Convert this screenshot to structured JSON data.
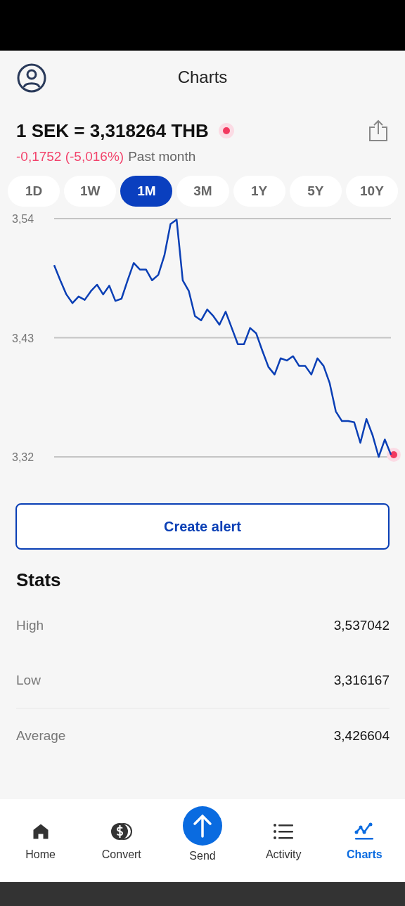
{
  "header": {
    "title": "Charts"
  },
  "rate": {
    "text": "1 SEK = 3,318264 THB",
    "live": true,
    "change": "-0,1752 (-5,016%)",
    "period": "Past month"
  },
  "ranges": [
    {
      "label": "1D",
      "selected": false
    },
    {
      "label": "1W",
      "selected": false
    },
    {
      "label": "1M",
      "selected": true
    },
    {
      "label": "3M",
      "selected": false
    },
    {
      "label": "1Y",
      "selected": false
    },
    {
      "label": "5Y",
      "selected": false
    },
    {
      "label": "10Y",
      "selected": false
    }
  ],
  "chart": {
    "chart_data": {
      "type": "line",
      "ylim": [
        3.32,
        3.54
      ],
      "yticks": [
        {
          "value": 3.54,
          "label": "3,54"
        },
        {
          "value": 3.43,
          "label": "3,43"
        },
        {
          "value": 3.32,
          "label": "3,32"
        }
      ],
      "series": [
        {
          "color": "#0a3fb5",
          "values": [
            3.497,
            3.483,
            3.47,
            3.462,
            3.468,
            3.465,
            3.473,
            3.479,
            3.47,
            3.478,
            3.464,
            3.466,
            3.483,
            3.499,
            3.493,
            3.493,
            3.483,
            3.488,
            3.506,
            3.535,
            3.539,
            3.483,
            3.473,
            3.45,
            3.446,
            3.456,
            3.45,
            3.442,
            3.454,
            3.439,
            3.424,
            3.424,
            3.439,
            3.434,
            3.418,
            3.403,
            3.396,
            3.411,
            3.409,
            3.413,
            3.404,
            3.404,
            3.396,
            3.411,
            3.404,
            3.388,
            3.362,
            3.353,
            3.353,
            3.352,
            3.333,
            3.355,
            3.34,
            3.32,
            3.336,
            3.322
          ]
        }
      ]
    }
  },
  "alert_button": "Create alert",
  "stats": {
    "title": "Stats",
    "rows": [
      {
        "label": "High",
        "value": "3,537042"
      },
      {
        "label": "Low",
        "value": "3,316167"
      },
      {
        "label": "Average",
        "value": "3,426604"
      }
    ]
  },
  "nav": [
    {
      "kind": "home",
      "label": "Home",
      "selected": false
    },
    {
      "kind": "coins",
      "label": "Convert",
      "selected": false
    },
    {
      "kind": "send",
      "label": "Send",
      "selected": false
    },
    {
      "kind": "list",
      "label": "Activity",
      "selected": false
    },
    {
      "kind": "chart",
      "label": "Charts",
      "selected": true
    }
  ]
}
